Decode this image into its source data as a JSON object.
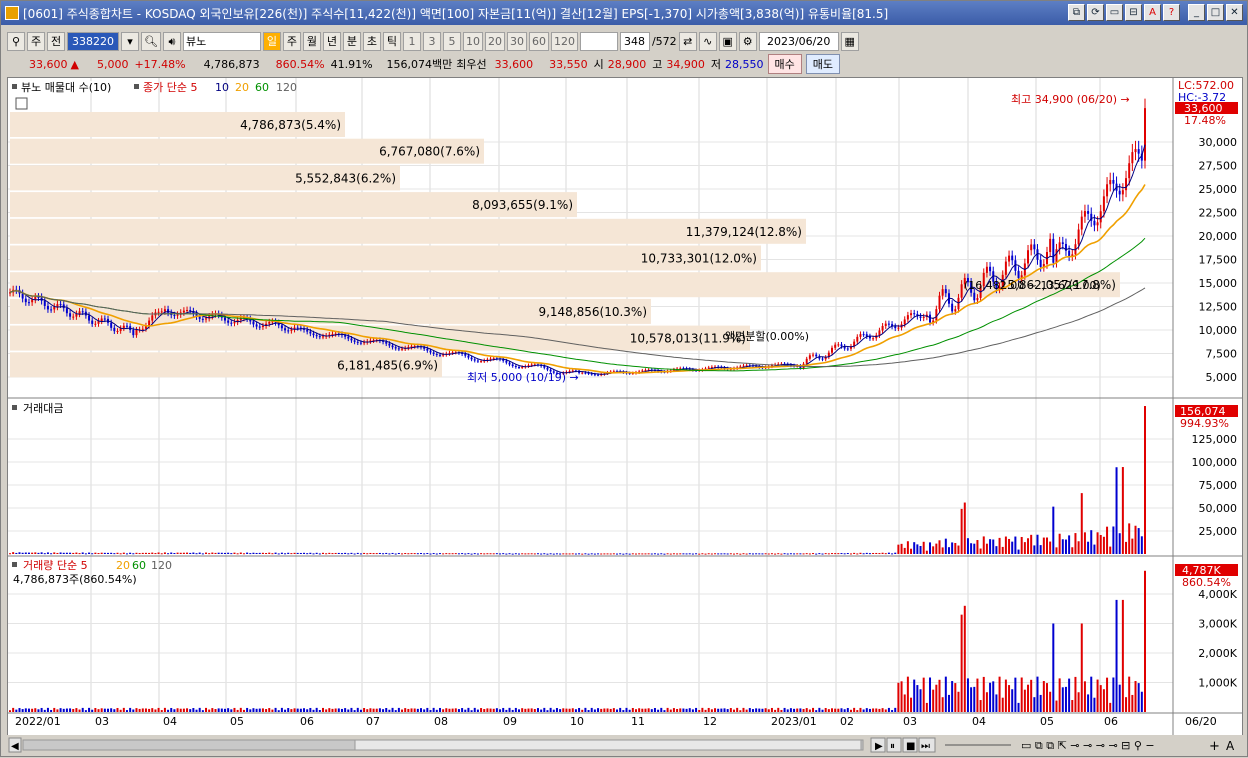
{
  "window": {
    "title": "[0601] 주식종합차트 - KOSDAQ 외국인보유[226(천)] 주식수[11,422(천)] 액면[100] 자본금[11(억)] 결산[12월] EPS[-1,370] 시가총액[3,838(억)] 유통비율[81.5]",
    "buttons": [
      "⧉",
      "⟳",
      "▭",
      "⊟",
      "A",
      "?",
      "_",
      "□",
      "✕"
    ]
  },
  "toolbar": {
    "market": "주",
    "prev": "전",
    "code": "338220",
    "stock_name": "뷰노",
    "periods": [
      "일",
      "주",
      "월",
      "년",
      "분",
      "초",
      "틱"
    ],
    "active_period": "일",
    "intervals": [
      "1",
      "3",
      "5",
      "10",
      "20",
      "30",
      "60",
      "120"
    ],
    "count": "348",
    "count_total": "/572",
    "date": "2023/06/20"
  },
  "quote": {
    "price": "33,600",
    "change": "5,000",
    "change_pct": "+17.48%",
    "volume": "4,786,873",
    "vol_ratio": "860.54%",
    "turnover": "41.91%",
    "amount": "156,074백만",
    "best_label": "최우선",
    "ask": "33,600",
    "bid": "33,550",
    "open_label": "시",
    "open": "28,900",
    "high_label": "고",
    "high": "34,900",
    "low_label": "저",
    "low": "28,550",
    "buy": "매수",
    "sell": "매도"
  },
  "legend_price": {
    "stock": "뷰노 매물대 수(10)",
    "ma_label": "종가 단순 5",
    "ma": [
      "10",
      "20",
      "60",
      "120"
    ]
  },
  "legend_amount": "거래대금",
  "legend_volume": {
    "label": "거래량 단순 5",
    "ma": [
      "20",
      "60",
      "120"
    ],
    "value": "4,786,873주(860.54%)"
  },
  "price_axis": [
    "30,000",
    "27,500",
    "25,000",
    "22,500",
    "20,000",
    "17,500",
    "15,000",
    "12,500",
    "10,000",
    "7,500",
    "5,000"
  ],
  "price_tags": {
    "lc": "LC:572.00",
    "hc": "HC:-3.72",
    "last": "33,600",
    "pct": "17.48%"
  },
  "amount_axis": [
    "125,000",
    "100,000",
    "75,000",
    "50,000",
    "25,000"
  ],
  "amount_tags": {
    "last": "156,074",
    "pct": "994.93%"
  },
  "volume_axis": [
    "4,000K",
    "3,000K",
    "2,000K",
    "1,000K"
  ],
  "volume_tags": {
    "last": "4,787K",
    "pct": "860.54%"
  },
  "x_labels": [
    "2022/01",
    "03",
    "04",
    "05",
    "06",
    "07",
    "08",
    "09",
    "10",
    "11",
    "12",
    "2023/01",
    "02",
    "03",
    "04",
    "05",
    "06",
    "06/20"
  ],
  "annotations": {
    "high": "최고 34,900 (06/20) →",
    "low": "최저 5,000 (10/19) →",
    "event": "액면분할(0.00%)",
    "range": "(16,482.00 ~ 13,629.00)"
  },
  "volume_profile": [
    "4,786,873(5.4%)",
    "6,767,080(7.6%)",
    "5,552,843(6.2%)",
    "8,093,655(9.1%)",
    "11,379,124(12.8%)",
    "10,733,301(12.0%)",
    "15,862,057(17.8%)",
    "9,148,856(10.3%)",
    "10,578,013(11.9%)",
    "6,181,485(6.9%)"
  ],
  "colors": {
    "up": "#e00000",
    "down": "#0000d0",
    "ma5": "#000080",
    "ma20": "#f0a000",
    "ma60": "#009000",
    "ma120": "#606060",
    "profile": "#f5e6d6"
  },
  "status_icons": [
    "play-icon",
    "pause-icon",
    "stop-icon",
    "fast-forward-icon",
    "zoom-out-icon",
    "zoom-in-icon",
    "text-icon"
  ]
}
